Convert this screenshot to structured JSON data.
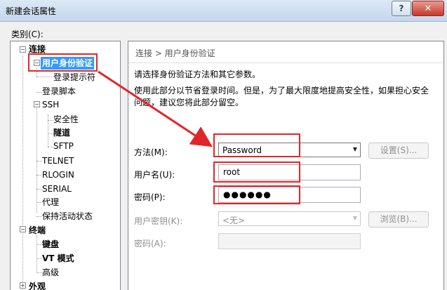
{
  "window": {
    "title": "新建会话属性",
    "help_glyph": "?",
    "close_glyph": "✕"
  },
  "category_label": "类别(C):",
  "tree": {
    "connection": "连接",
    "auth": "用户身份验证",
    "login_prompt": "登录提示符",
    "login_script": "登录脚本",
    "ssh": "SSH",
    "security": "安全性",
    "tunnel": "隧道",
    "sftp": "SFTP",
    "telnet": "TELNET",
    "rlogin": "RLOGIN",
    "serial": "SERIAL",
    "proxy": "代理",
    "keepalive": "保持活动状态",
    "terminal": "终端",
    "keyboard": "键盘",
    "vt_mode": "VT 模式",
    "advanced": "高级",
    "appearance": "外观"
  },
  "panel": {
    "breadcrumb": "连接 > 用户身份验证",
    "heading": "请选择身份验证方法和其它参数。",
    "desc": "使用此部分以节省登录时间。但是，为了最大限度地提高安全性，如果担心安全问题，建议您将此部分留空。",
    "method_label": "方法(M):",
    "method_value": "Password",
    "settings_btn": "设置(S)...",
    "username_label": "用户名(U):",
    "username_value": "root",
    "password_label": "密码(P):",
    "password_value": "●●●●●●",
    "userkey_label": "用户密钥(K):",
    "userkey_value": "<无>",
    "browse_btn": "浏览(B)...",
    "passphrase_label": "密码(A):",
    "passphrase_value": ""
  },
  "colors": {
    "highlight": "#e1262b",
    "selection": "#3399ff"
  }
}
